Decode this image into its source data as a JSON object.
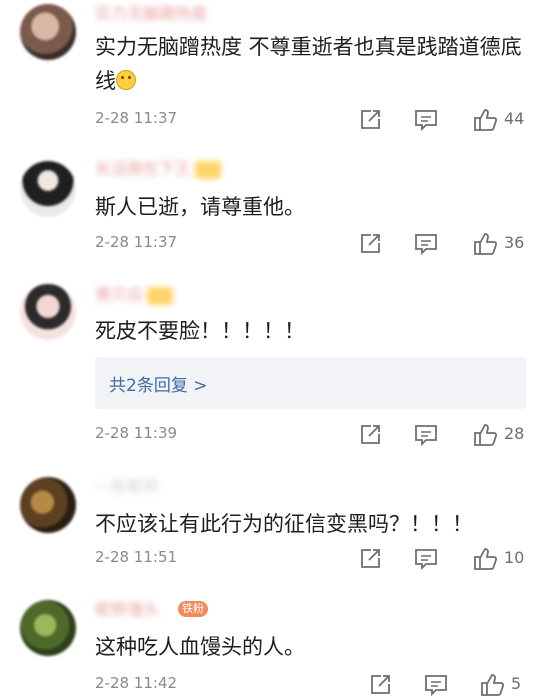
{
  "comments": [
    {
      "username": "实力无脑蹭热度",
      "text": "实力无脑蹭热度 不尊重逝者也真是践踏道德底线",
      "emoji": "smile-emoji",
      "time": "2-28 11:37",
      "likes": "44"
    },
    {
      "username": "长沼南在下王",
      "text": "斯人已逝，请尊重他。",
      "time": "2-28 11:37",
      "likes": "36"
    },
    {
      "username": "黄贝白",
      "text": "死皮不要脸！！！！！",
      "reply_link": "共2条回复 >",
      "time": "2-28 11:39",
      "likes": "28"
    },
    {
      "username": "一些昵称",
      "text": "不应该让有此行为的征信变黑吗？！！！",
      "time": "2-28 11:51",
      "likes": "10"
    },
    {
      "username": "昵称馒头",
      "badge": "铁粉",
      "text": "这种吃人血馒头的人。",
      "time": "2-28 11:42",
      "likes": "5"
    }
  ],
  "colors": {
    "reply_link": "#3c6ea5",
    "meta_gray": "#8a8a8a",
    "icon_gray": "#6f6f6f"
  },
  "icons": {
    "share": "share-icon",
    "comment": "comment-icon",
    "like": "thumbs-up-icon"
  }
}
